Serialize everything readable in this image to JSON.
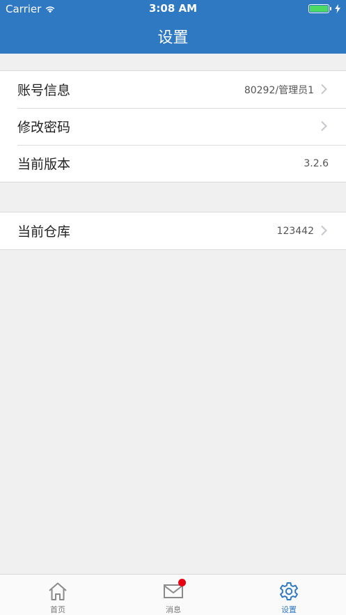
{
  "status_bar": {
    "carrier": "Carrier",
    "time": "3:08 AM",
    "battery_color": "#4cd964"
  },
  "header": {
    "title": "设置",
    "background": "#2f78c2"
  },
  "settings": {
    "group1": [
      {
        "label": "账号信息",
        "value": "80292/管理员1",
        "chevron": true
      },
      {
        "label": "修改密码",
        "value": "",
        "chevron": true
      },
      {
        "label": "当前版本",
        "value": "3.2.6",
        "chevron": false
      }
    ],
    "group2": [
      {
        "label": "当前仓库",
        "value": "123442",
        "chevron": true
      }
    ]
  },
  "tabbar": {
    "items": [
      {
        "label": "首页",
        "icon": "home-icon",
        "active": false
      },
      {
        "label": "消息",
        "icon": "mail-icon",
        "active": false,
        "badge": true
      },
      {
        "label": "设置",
        "icon": "gear-icon",
        "active": true
      }
    ],
    "active_color": "#2f78c2",
    "badge_color": "#e60012"
  }
}
